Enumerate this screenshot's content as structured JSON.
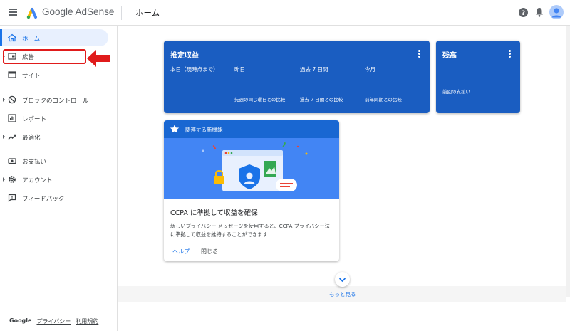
{
  "header": {
    "brand": "Google AdSense",
    "page_title": "ホーム"
  },
  "sidebar": {
    "items": [
      {
        "label": "ホーム"
      },
      {
        "label": "広告"
      },
      {
        "label": "サイト"
      },
      {
        "label": "ブロックのコントロール"
      },
      {
        "label": "レポート"
      },
      {
        "label": "最適化"
      },
      {
        "label": "お支払い"
      },
      {
        "label": "アカウント"
      },
      {
        "label": "フィードバック"
      }
    ],
    "footer": {
      "google": "Google",
      "privacy": "プライバシー",
      "terms": "利用規約"
    }
  },
  "earnings_card": {
    "title": "推定収益",
    "columns": [
      {
        "head": "本日（現時点まで）",
        "sub": ""
      },
      {
        "head": "昨日",
        "sub": "先週の同じ曜日との比較"
      },
      {
        "head": "過去 7 日間",
        "sub": "過去 7 日間との比較"
      },
      {
        "head": "今月",
        "sub": "前年同期との比較"
      }
    ]
  },
  "balance_card": {
    "title": "残高",
    "sub": "前回の支払い"
  },
  "feature_card": {
    "header": "関連する新機能",
    "title": "CCPA に準拠して収益を確保",
    "description": "新しいプライバシー メッセージを使用すると、CCPA プライバシー法に準拠して収益を維持することができます",
    "help_label": "ヘルプ",
    "close_label": "閉じる"
  },
  "more": {
    "label": "もっと見る"
  },
  "colors": {
    "accent": "#1a73e8",
    "card_blue": "#1a5dc1",
    "highlight": "#e01b1b"
  }
}
